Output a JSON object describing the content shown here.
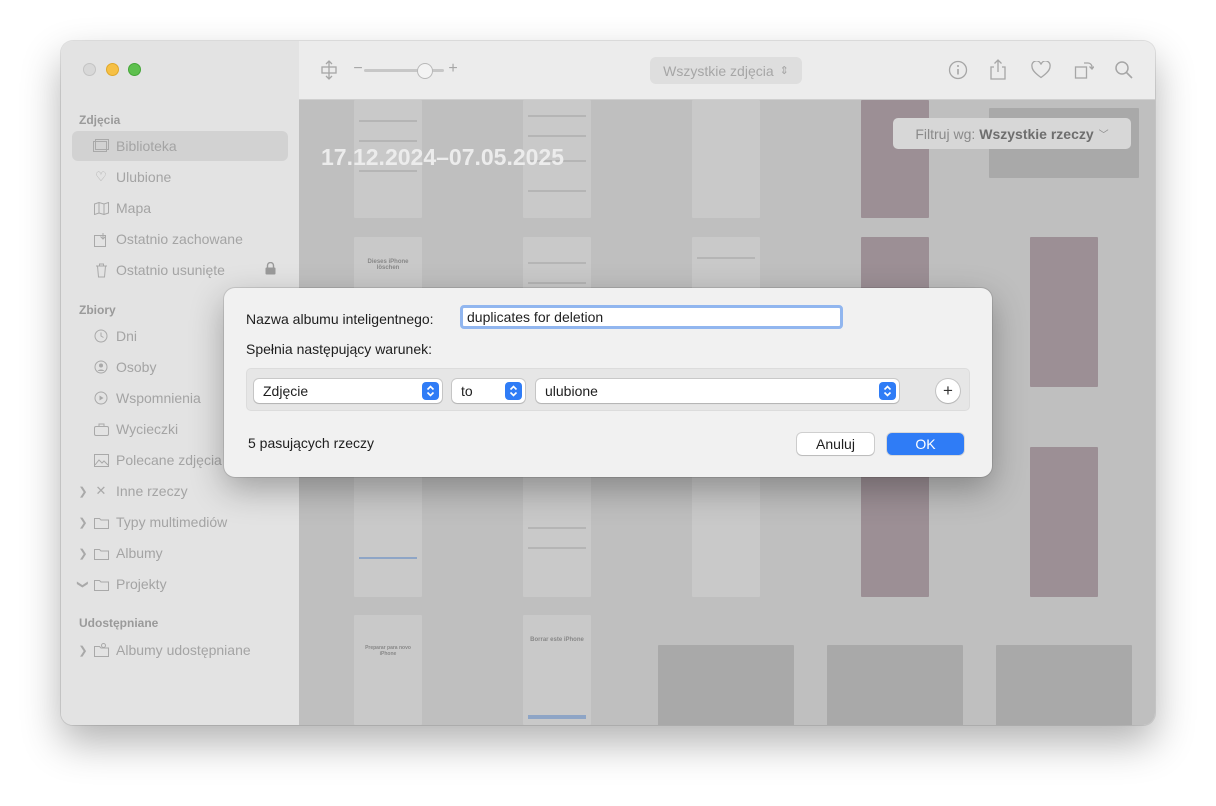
{
  "sidebar": {
    "sections": [
      {
        "heading": "Zdjęcia",
        "items": [
          {
            "label": "Biblioteka",
            "icon": "photo-library-icon",
            "selected": true
          },
          {
            "label": "Ulubione",
            "icon": "heart-icon"
          },
          {
            "label": "Mapa",
            "icon": "map-icon"
          },
          {
            "label": "Ostatnio zachowane",
            "icon": "recently-saved-icon"
          },
          {
            "label": "Ostatnio usunięte",
            "icon": "trash-icon",
            "locked": true
          }
        ]
      },
      {
        "heading": "Zbiory",
        "items": [
          {
            "label": "Dni",
            "icon": "clock-icon"
          },
          {
            "label": "Osoby",
            "icon": "person-icon"
          },
          {
            "label": "Wspomnienia",
            "icon": "memories-icon"
          },
          {
            "label": "Wycieczki",
            "icon": "suitcase-icon"
          },
          {
            "label": "Polecane zdjęcia",
            "icon": "featured-photos-icon"
          },
          {
            "label": "Inne rzeczy",
            "icon": "tools-icon"
          },
          {
            "label": "Typy multimediów",
            "icon": "folder-icon"
          },
          {
            "label": "Albumy",
            "icon": "folder-icon"
          },
          {
            "label": "Projekty",
            "icon": "folder-icon"
          }
        ]
      },
      {
        "heading": "Udostępniane",
        "items": [
          {
            "label": "Albumy udostępniane",
            "icon": "shared-album-icon"
          }
        ]
      }
    ]
  },
  "toolbar": {
    "view_selector": "Wszystkie zdjęcia",
    "zoom_minus": "−",
    "zoom_plus": "+",
    "zoom_level": 0.78,
    "icons": [
      "aspect-toggle-icon",
      "info-icon",
      "share-icon",
      "heart-icon",
      "rotate-icon",
      "search-icon"
    ]
  },
  "content": {
    "date_range": "17.12.2024–07.05.2025",
    "filter_prefix": "Filtruj wg:",
    "filter_value": "Wszystkie rzeczy",
    "thumbnail_text": {
      "de_title": "Dieses iPhone löschen",
      "es_title": "Borrar este iPhone",
      "pt_title": "Preparar para novo iPhone"
    }
  },
  "dialog": {
    "name_label": "Nazwa albumu inteligentnego:",
    "name_value": "duplicates for deletion",
    "condition_label": "Spełnia następujący warunek:",
    "rule": {
      "field": "Zdjęcie",
      "operator": "to",
      "value": "ulubione"
    },
    "add_symbol": "+",
    "match_count": "5 pasujących rzeczy",
    "cancel_label": "Anuluj",
    "ok_label": "OK"
  },
  "colors": {
    "accent": "#2f7cf6",
    "sidebar_bg": "#e3e3e3",
    "dialog_bg": "#f1f1f1"
  }
}
